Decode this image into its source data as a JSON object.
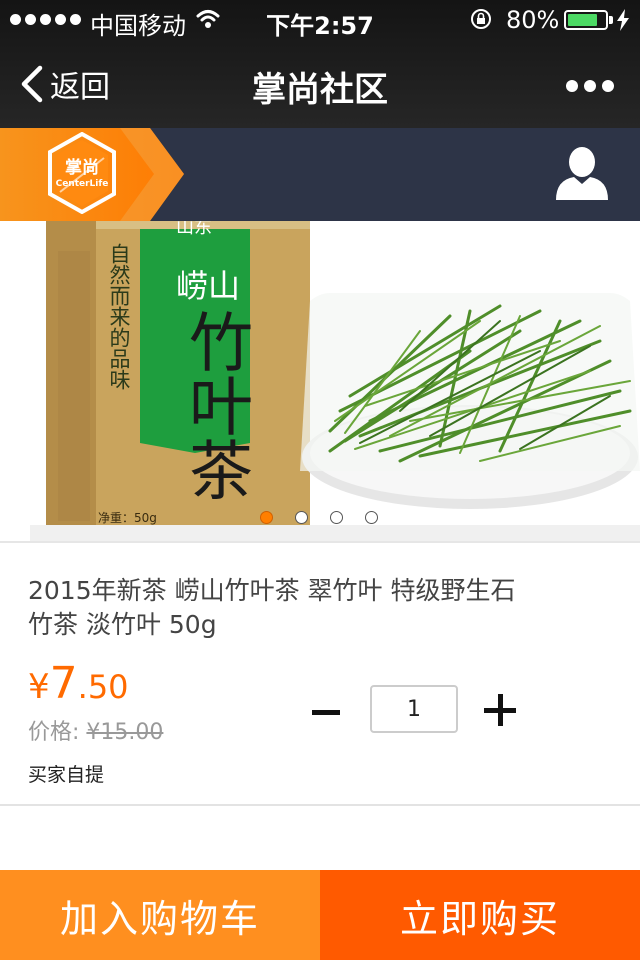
{
  "status_bar": {
    "carrier": "中国移动",
    "time": "下午2:57",
    "battery_percent": "80%",
    "battery_level": 0.8,
    "icons": [
      "signal-dots-icon",
      "wifi-icon",
      "rotation-lock-icon",
      "battery-icon",
      "charging-bolt-icon"
    ]
  },
  "nav": {
    "back_label": "返回",
    "title": "掌尚社区",
    "icons": [
      "chevron-left-icon",
      "more-dots-icon"
    ]
  },
  "brand": {
    "logo_text": "掌尚",
    "logo_subtext": "CenterLife",
    "icons": [
      "brand-logo-icon",
      "user-icon"
    ]
  },
  "product_image": {
    "package_text": {
      "brand": "山东",
      "slogan": "自然而来的品味",
      "name_line1": "崂山",
      "name_line2": "竹叶茶",
      "weight": "净重：50g"
    },
    "slide_count": 4,
    "active_slide": 1
  },
  "product": {
    "title": "2015年新茶 崂山竹叶茶 翠竹叶 特级野生石竹茶 淡竹叶 50g",
    "price_currency": "¥",
    "price_integer": "7",
    "price_decimal": ".50",
    "original_price_label": "价格:",
    "original_price": "¥15.00",
    "delivery": "买家自提"
  },
  "quantity": {
    "value": "1"
  },
  "actions": {
    "add_to_cart": "加入购物车",
    "buy_now": "立即购买"
  },
  "colors": {
    "accent_orange": "#ff8f1f",
    "buy_orange": "#ff5a00",
    "price": "#ff6a00",
    "brand_bar": "#2d3447",
    "battery": "#4cd964"
  }
}
